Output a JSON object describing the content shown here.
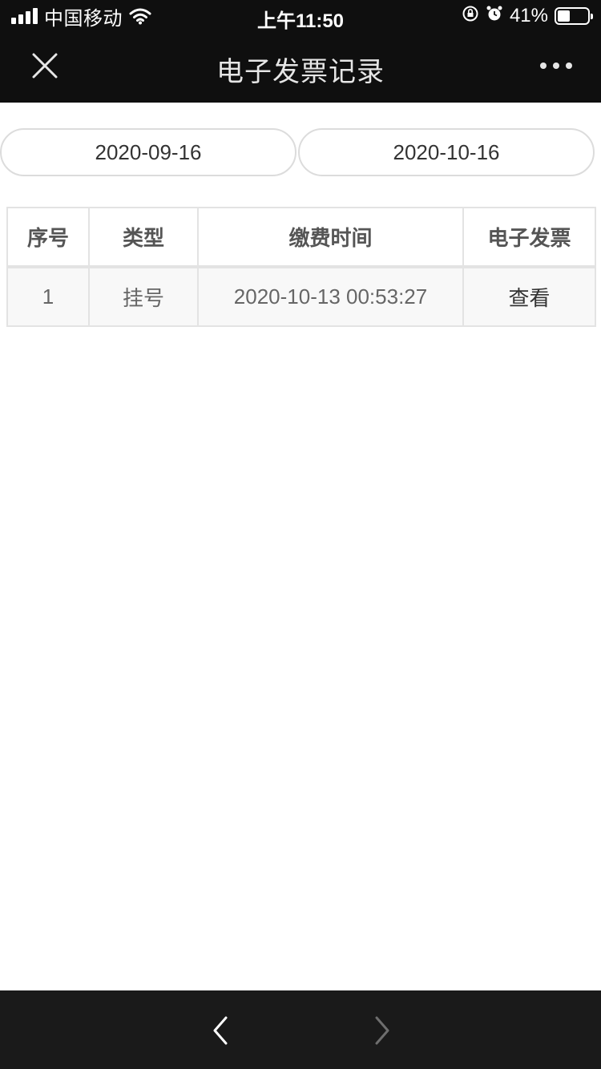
{
  "status_bar": {
    "carrier": "中国移动",
    "time": "上午11:50",
    "battery_percent": "41%",
    "battery_level": 0.41
  },
  "nav": {
    "title": "电子发票记录"
  },
  "date_range": {
    "start": "2020-09-16",
    "end": "2020-10-16"
  },
  "table": {
    "headers": [
      "序号",
      "类型",
      "缴费时间",
      "电子发票"
    ],
    "rows": [
      {
        "index": "1",
        "type": "挂号",
        "time": "2020-10-13 00:53:27",
        "invoice": "查看"
      }
    ]
  },
  "colors": {
    "topbar": "#0f0f0f",
    "bottombar": "#1a1a1a",
    "border": "#e3e3e3"
  }
}
